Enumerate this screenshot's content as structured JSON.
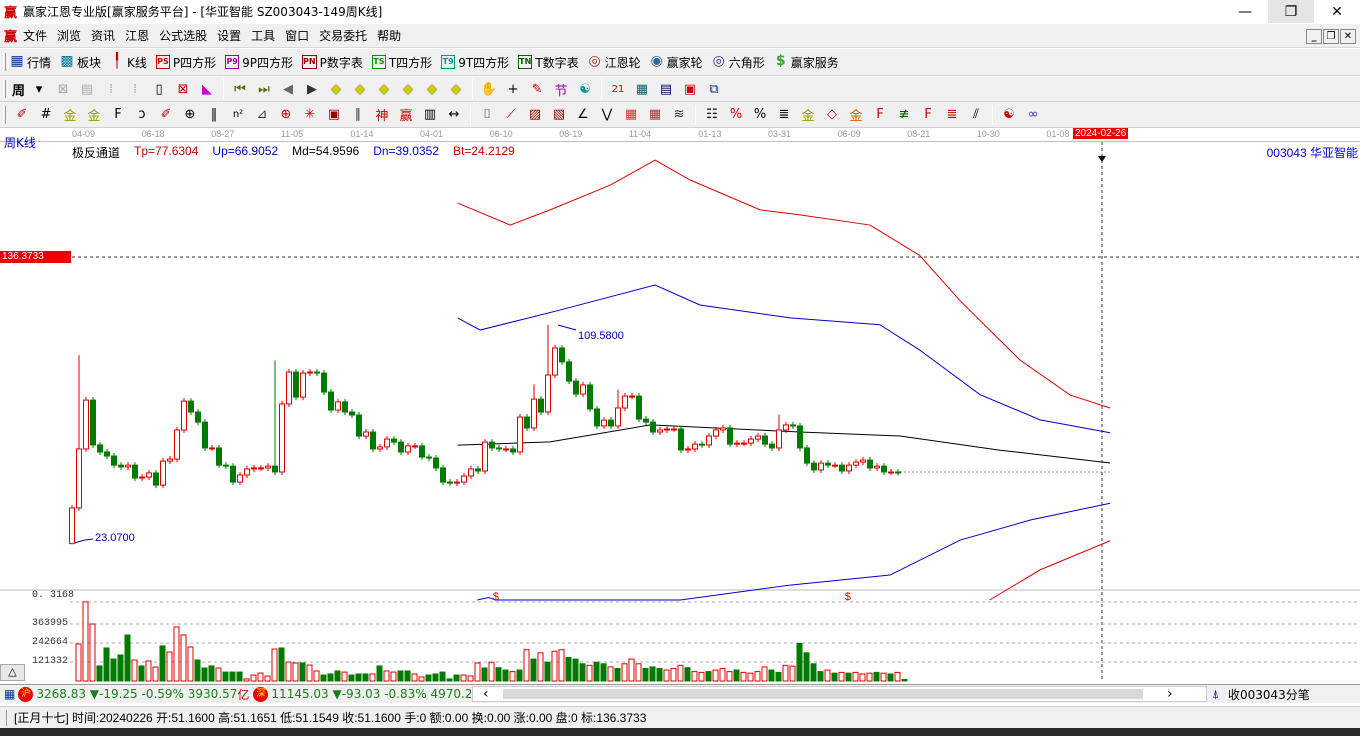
{
  "window": {
    "logo": "赢",
    "title": "赢家江恩专业版[赢家服务平台] - [华亚智能  SZ003043-149周K线]",
    "minimize": "—",
    "restore": "❐",
    "close": "✕"
  },
  "menu": {
    "logo": "赢",
    "items": [
      "文件",
      "浏览",
      "资讯",
      "江恩",
      "公式选股",
      "设置",
      "工具",
      "窗口",
      "交易委托",
      "帮助"
    ],
    "mdi": [
      "_",
      "❐",
      "✕"
    ]
  },
  "toolbar1": [
    {
      "icon": "quotes",
      "glyph": "▦",
      "label": "行情",
      "color": "#003399"
    },
    {
      "icon": "sector",
      "glyph": "▩",
      "label": "板块",
      "color": "#007799"
    },
    {
      "icon": "kline",
      "glyph": "╿",
      "label": "K线",
      "color": "#cc0000"
    },
    {
      "icon": "ps",
      "glyph": "PS",
      "label": "P四方形",
      "color": "#cc0000"
    },
    {
      "icon": "p9",
      "glyph": "P9",
      "label": "9P四方形",
      "color": "#990099"
    },
    {
      "icon": "pn",
      "glyph": "PN",
      "label": "P数字表",
      "color": "#990000"
    },
    {
      "icon": "ts",
      "glyph": "TS",
      "label": "T四方形",
      "color": "#009900"
    },
    {
      "icon": "t9",
      "glyph": "T9",
      "label": "9T四方形",
      "color": "#009999"
    },
    {
      "icon": "tn",
      "glyph": "TN",
      "label": "T数字表",
      "color": "#006600"
    },
    {
      "icon": "gann-wheel",
      "glyph": "◎",
      "label": "江恩轮",
      "color": "#993300"
    },
    {
      "icon": "winner-wheel",
      "glyph": "◉",
      "label": "赢家轮",
      "color": "#336699"
    },
    {
      "icon": "hexagon",
      "glyph": "◎",
      "label": "六角形",
      "color": "#333399"
    },
    {
      "icon": "dollar",
      "glyph": "$",
      "label": "赢家服务",
      "color": "#33aa33"
    }
  ],
  "toolbar2": {
    "period_label": "周",
    "icons": [
      {
        "n": "period-dropdown",
        "g": "▾",
        "c": "#000"
      },
      {
        "n": "formula",
        "g": "⊠",
        "c": "#aaa"
      },
      {
        "n": "notes",
        "g": "▤",
        "c": "#aaa"
      },
      {
        "n": "bars-3",
        "g": "⁞",
        "c": "#aaa"
      },
      {
        "n": "bars-9",
        "g": "⁞",
        "c": "#aaa"
      },
      {
        "n": "candle-type",
        "g": "▯",
        "c": "#000"
      },
      {
        "n": "zoom-box",
        "g": "⊠",
        "c": "#c00"
      },
      {
        "n": "color-flag",
        "g": "◣",
        "c": "#c0c"
      },
      {
        "sep": true
      },
      {
        "n": "first",
        "g": "⏮",
        "c": "#660"
      },
      {
        "n": "last",
        "g": "⏭",
        "c": "#660"
      },
      {
        "n": "left",
        "g": "◀",
        "c": "#666"
      },
      {
        "n": "right",
        "g": "▶",
        "c": "#333"
      },
      {
        "n": "nav-left",
        "g": "◆",
        "c": "#cc0"
      },
      {
        "n": "nav-right",
        "g": "◆",
        "c": "#cc0"
      },
      {
        "n": "expand",
        "g": "◆",
        "c": "#cc0"
      },
      {
        "n": "compress",
        "g": "◆",
        "c": "#cc0"
      },
      {
        "n": "zoom-in",
        "g": "◆",
        "c": "#cc0"
      },
      {
        "n": "zoom-out",
        "g": "◆",
        "c": "#cc0"
      },
      {
        "sep": true
      },
      {
        "n": "hand",
        "g": "✋",
        "c": "#333"
      },
      {
        "n": "crosshair",
        "g": "+",
        "c": "#000"
      },
      {
        "n": "pen",
        "g": "✎",
        "c": "#c00"
      },
      {
        "n": "festival",
        "g": "节",
        "c": "#909"
      },
      {
        "n": "calc",
        "g": "☯",
        "c": "#099"
      },
      {
        "sep": true
      },
      {
        "n": "calendar",
        "g": "21",
        "c": "#c00"
      },
      {
        "n": "calculator",
        "g": "▦",
        "c": "#066"
      },
      {
        "n": "document",
        "g": "▤",
        "c": "#006"
      },
      {
        "n": "save",
        "g": "▣",
        "c": "#c00"
      },
      {
        "n": "network",
        "g": "⧉",
        "c": "#036"
      }
    ]
  },
  "toolbar3": {
    "icons": [
      {
        "n": "draw-pen",
        "g": "✐",
        "c": "#c00"
      },
      {
        "n": "hash",
        "g": "#",
        "c": "#000"
      },
      {
        "n": "gold-1",
        "g": "金",
        "c": "#990"
      },
      {
        "n": "gold-2",
        "g": "金",
        "c": "#990"
      },
      {
        "n": "fib",
        "g": "F",
        "c": "#000"
      },
      {
        "n": "spiral",
        "g": "ↄ",
        "c": "#000"
      },
      {
        "n": "pen-axis",
        "g": "✐",
        "c": "#c00"
      },
      {
        "n": "circle-grid",
        "g": "⊕",
        "c": "#000"
      },
      {
        "n": "grid-lines",
        "g": "‖",
        "c": "#000"
      },
      {
        "n": "square-n",
        "g": "n²",
        "c": "#000"
      },
      {
        "n": "fan",
        "g": "⊿",
        "c": "#333"
      },
      {
        "n": "target",
        "g": "⊕",
        "c": "#c00"
      },
      {
        "n": "star",
        "g": "✳",
        "c": "#c00"
      },
      {
        "n": "box",
        "g": "▣",
        "c": "#900"
      },
      {
        "n": "parallel",
        "g": "∥",
        "c": "#333"
      },
      {
        "n": "god",
        "g": "神",
        "c": "#c00"
      },
      {
        "n": "win",
        "g": "赢",
        "c": "#c00"
      },
      {
        "n": "ruler",
        "g": "▥",
        "c": "#000"
      },
      {
        "n": "measure",
        "g": "↔",
        "c": "#000"
      },
      {
        "sep": true
      },
      {
        "n": "period-box",
        "g": "⌷",
        "c": "#333"
      },
      {
        "n": "gann-fan",
        "g": "⟋",
        "c": "#c00"
      },
      {
        "n": "gann-box",
        "g": "▨",
        "c": "#900"
      },
      {
        "n": "gann-square",
        "g": "▧",
        "c": "#900"
      },
      {
        "n": "angle",
        "g": "∠",
        "c": "#000"
      },
      {
        "n": "zigzag",
        "g": "⋁",
        "c": "#000"
      },
      {
        "n": "grid-red",
        "g": "▦",
        "c": "#c33"
      },
      {
        "n": "grid-dark",
        "g": "▦",
        "c": "#933"
      },
      {
        "n": "parallel-lines",
        "g": "≋",
        "c": "#333"
      },
      {
        "sep": true
      },
      {
        "n": "table",
        "g": "☷",
        "c": "#000"
      },
      {
        "n": "percent-tool",
        "g": "%",
        "c": "#c00"
      },
      {
        "n": "percent",
        "g": "%",
        "c": "#000"
      },
      {
        "n": "levels",
        "g": "≣",
        "c": "#000"
      },
      {
        "n": "gold-level",
        "g": "金",
        "c": "#990"
      },
      {
        "n": "cycle",
        "g": "◇",
        "c": "#c00"
      },
      {
        "n": "gold-cycle",
        "g": "金",
        "c": "#c60"
      },
      {
        "n": "time-f",
        "g": "F",
        "c": "#c00"
      },
      {
        "n": "green-lines",
        "g": "≢",
        "c": "#060"
      },
      {
        "n": "time-f2",
        "g": "F",
        "c": "#c00"
      },
      {
        "n": "red-lines",
        "g": "≣",
        "c": "#c00"
      },
      {
        "n": "fan-lines",
        "g": "⫽",
        "c": "#000"
      },
      {
        "sep": true
      },
      {
        "n": "taiji",
        "g": "☯",
        "c": "#c00"
      },
      {
        "n": "infinity",
        "g": "∞",
        "c": "#33c"
      }
    ]
  },
  "side_label": "周K线",
  "date_axis": {
    "labels": [
      "04-09",
      "06-18",
      "08-27",
      "11-05",
      "01-14",
      "04-01",
      "06-10",
      "08-19",
      "11-04",
      "01-13",
      "03-31",
      "06-09",
      "08-21",
      "10-30",
      "01-08"
    ],
    "cursor_date": "2024-02-26"
  },
  "indicator": {
    "name": "极反通道",
    "tp": "Tp=77.6304",
    "up": "Up=66.9052",
    "md": "Md=54.9596",
    "dn": "Dn=39.0352",
    "bt": "Bt=24.2129"
  },
  "stock_label": "003043  华亚智能",
  "cursor_price_label": "136.3733",
  "high_label": "109.5800",
  "low_label": "23.0700",
  "volume_axis": {
    "top_label": "0. 3168",
    "ticks": [
      "363995",
      "242664",
      "121332"
    ],
    "marker": "$"
  },
  "panel_toggle": "△",
  "colors": {
    "up": "#e00000",
    "down": "#007a00",
    "tp": "#e00000",
    "up_line": "#0000cc",
    "md": "#000000",
    "dn": "#0000cc",
    "bt": "#e00000"
  },
  "chart_data": {
    "type": "candlestick",
    "period": "weekly",
    "first_open": 23.07,
    "high_mark": 109.58,
    "low_mark": 23.07,
    "cursor_price": 136.3733,
    "closes": [
      37.2,
      60.5,
      79.8,
      62.1,
      59.3,
      57.7,
      54.1,
      53.4,
      54.1,
      49.0,
      49.4,
      51.0,
      46.2,
      55.7,
      56.5,
      68.0,
      79.4,
      75.1,
      71.1,
      60.9,
      60.9,
      54.1,
      53.7,
      47.4,
      50.2,
      52.6,
      53.0,
      53.0,
      53.7,
      51.4,
      78.3,
      90.9,
      81.0,
      90.5,
      90.9,
      90.5,
      83.0,
      75.9,
      79.1,
      75.1,
      73.9,
      65.6,
      67.2,
      60.5,
      61.3,
      64.4,
      63.2,
      59.3,
      61.7,
      61.7,
      57.3,
      56.9,
      53.0,
      47.4,
      47.0,
      47.4,
      49.8,
      52.6,
      51.8,
      63.2,
      60.9,
      60.5,
      60.5,
      59.3,
      73.1,
      68.8,
      80.2,
      75.1,
      89.7,
      100.4,
      94.9,
      87.3,
      82.2,
      85.8,
      76.3,
      69.6,
      71.9,
      69.6,
      76.7,
      81.4,
      81.4,
      72.3,
      71.1,
      67.2,
      68.0,
      68.4,
      68.4,
      60.1,
      60.5,
      62.4,
      62.1,
      65.6,
      68.0,
      68.8,
      62.4,
      62.8,
      62.8,
      64.4,
      65.6,
      62.4,
      60.9,
      68.0,
      70.0,
      69.6,
      60.9,
      54.9,
      52.2,
      54.9,
      54.1,
      54.1,
      51.8,
      54.1,
      55.3,
      56.1,
      53.0,
      53.7,
      51.4,
      51.4,
      51.16
    ],
    "wick_highs": {
      "2": 97.6,
      "69": 109.58,
      "30": 95.5,
      "67": 86.0,
      "79": 84.0,
      "102": 74.0
    },
    "volumes": [
      236000,
      505000,
      364000,
      96000,
      211000,
      140000,
      166000,
      294000,
      134000,
      96000,
      128000,
      89000,
      224000,
      185000,
      345000,
      294000,
      217000,
      134000,
      83000,
      96000,
      83000,
      57000,
      57000,
      57000,
      13000,
      38000,
      51000,
      32000,
      204000,
      211000,
      121000,
      115000,
      115000,
      102000,
      64000,
      38000,
      45000,
      64000,
      57000,
      38000,
      45000,
      45000,
      45000,
      96000,
      64000,
      57000,
      64000,
      64000,
      45000,
      26000,
      38000,
      45000,
      57000,
      13000,
      38000,
      38000,
      32000,
      115000,
      83000,
      120000,
      85000,
      70000,
      60000,
      70000,
      200000,
      140000,
      180000,
      120000,
      190000,
      200000,
      150000,
      140000,
      110000,
      100000,
      120000,
      110000,
      90000,
      80000,
      110000,
      140000,
      110000,
      80000,
      90000,
      80000,
      70000,
      80000,
      100000,
      85000,
      60000,
      55000,
      60000,
      70000,
      80000,
      60000,
      70000,
      55000,
      50000,
      60000,
      90000,
      70000,
      55000,
      100000,
      95000,
      240000,
      180000,
      110000,
      60000,
      70000,
      50000,
      55000,
      50000,
      55000,
      45000,
      50000,
      55000,
      50000,
      45000,
      55000,
      10000
    ],
    "volume_ticks": [
      121332,
      242664,
      363995
    ],
    "channel": {
      "tp": [
        [
          56.1,
          157.7
        ],
        [
          63.6,
          149
        ],
        [
          69.3,
          155
        ],
        [
          77.9,
          164.8
        ],
        [
          84.3,
          174.7
        ],
        [
          89.3,
          166.8
        ],
        [
          99.3,
          155
        ],
        [
          105,
          153
        ],
        [
          115,
          149
        ],
        [
          122.1,
          137
        ],
        [
          127.9,
          119
        ],
        [
          136.4,
          95.7
        ],
        [
          143.6,
          81.8
        ],
        [
          149.3,
          76.7
        ]
      ],
      "up": [
        [
          56.1,
          112.3
        ],
        [
          59.3,
          107.5
        ],
        [
          70.7,
          115.4
        ],
        [
          84.3,
          125.3
        ],
        [
          90.7,
          117.4
        ],
        [
          103.6,
          112.3
        ],
        [
          116.4,
          109.6
        ],
        [
          122.1,
          99.6
        ],
        [
          130.7,
          82
        ],
        [
          139.3,
          72
        ],
        [
          149.3,
          66.9
        ]
      ],
      "md": [
        [
          56.1,
          62
        ],
        [
          69.3,
          63.3
        ],
        [
          83.6,
          70
        ],
        [
          105,
          67.2
        ],
        [
          119.3,
          65.6
        ],
        [
          133.6,
          60
        ],
        [
          149.3,
          54.96
        ]
      ],
      "dn": [
        [
          58.9,
          0.8
        ],
        [
          60.5,
          1.8
        ],
        [
          61.5,
          0.8
        ],
        [
          87.9,
          0.8
        ],
        [
          103.6,
          6.7
        ],
        [
          117.9,
          10.7
        ],
        [
          127.9,
          24.5
        ],
        [
          137.9,
          32.4
        ],
        [
          149.3,
          39.04
        ]
      ],
      "bt": [
        [
          132.1,
          0.8
        ],
        [
          139.3,
          12.7
        ],
        [
          149.3,
          24.21
        ]
      ]
    },
    "dollar_markers_at_week": [
      61.1,
      111.4
    ]
  },
  "index_bar": {
    "sh_icon": "沪",
    "sh": "3268.83 ▼-19.25 -0.59% 3930.57",
    "sh_unit": "亿",
    "sz_icon": "深",
    "sz": "11145.03 ▼-93.03 -0.83% 4970.20",
    "scroll_left": "‹",
    "scroll_right": "›",
    "tick_label": "收003043分笔"
  },
  "status": {
    "text": "[正月十七] 时间:20240226 开:51.1600 高:51.1651 低:51.1549 收:51.1600 手:0 额:0.00 换:0.00 涨:0.00 盘:0 标:136.3733"
  }
}
